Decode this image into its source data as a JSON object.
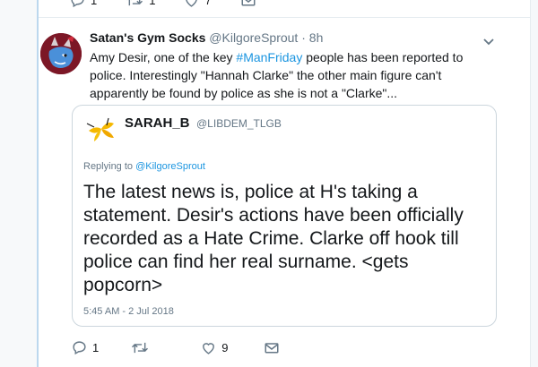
{
  "previous_tweet_actions": {
    "reply_count": "1",
    "retweet_count": "1",
    "like_count": "7"
  },
  "tweet": {
    "author_name": "Satan's Gym Socks",
    "author_handle": "@KilgoreSprout",
    "separator": "·",
    "time": "8h",
    "text_before": "Amy Desir, one of the key ",
    "hashtag": "#ManFriday",
    "text_after": " people has been reported to police. Interestingly \"Hannah Clarke\" the other main figure can't apparently be found by police as she is not a \"Clarke\"..."
  },
  "quoted_tweet": {
    "author_name": "SARAH_B",
    "author_handle": "@LIBDEM_TLGB",
    "replying_prefix": "Replying to ",
    "replying_to": "@KilgoreSprout",
    "text": "The latest news is, police at H's taking a statement. Desir's actions have been officially recorded as a Hate Crime. Clarke off hook till police can find her real surname. <gets popcorn>",
    "timestamp": "5:45 AM - 2 Jul 2018"
  },
  "tweet_actions": {
    "reply_count": "1",
    "retweet_count": "",
    "like_count": "9"
  },
  "colors": {
    "link": "#1b95e0",
    "muted": "#657786",
    "text": "#14171a",
    "border": "#ccd6dd"
  },
  "icons": [
    "reply-icon",
    "retweet-icon",
    "like-icon",
    "dm-icon",
    "chevron-down-icon"
  ]
}
